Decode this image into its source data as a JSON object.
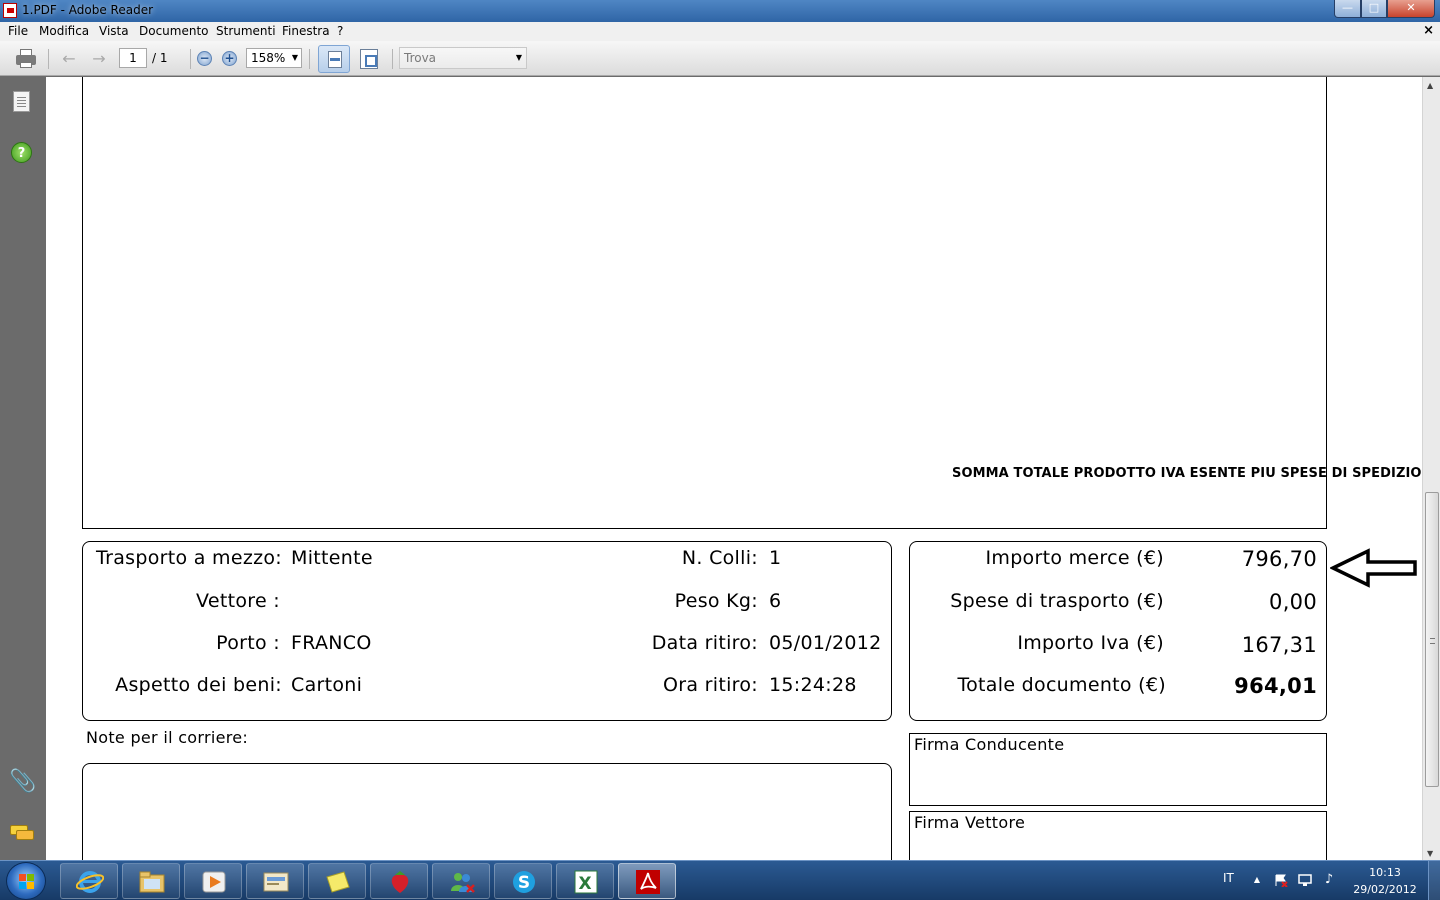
{
  "window": {
    "title": "1.PDF - Adobe Reader",
    "min_glyph": "—",
    "max_glyph": "□",
    "close_glyph": "✕"
  },
  "menu": {
    "items": [
      "File",
      "Modifica",
      "Vista",
      "Documento",
      "Strumenti",
      "Finestra",
      "?"
    ],
    "close_doc": "×"
  },
  "toolbar": {
    "page_current": "1",
    "page_total": "/ 1",
    "zoom": "158%",
    "find_placeholder": "Trova",
    "prev_glyph": "←",
    "next_glyph": "→",
    "zoom_out_glyph": "−",
    "zoom_in_glyph": "+",
    "dropdown_glyph": "▼"
  },
  "sidebar": {
    "help_glyph": "?",
    "attach_glyph": "📎",
    "icons": [
      "pages-icon",
      "help-icon",
      "attachments-icon",
      "comments-icon"
    ]
  },
  "document": {
    "total_note": "SOMMA TOTALE PRODOTTO IVA ESENTE PIU SPESE DI SPEDIZIONI",
    "shipping": {
      "trasporto_label": "Trasporto a mezzo:",
      "trasporto_value": "Mittente",
      "vettore_label": "Vettore :",
      "vettore_value": "",
      "porto_label": "Porto :",
      "porto_value": "FRANCO",
      "aspetto_label": "Aspetto dei beni:",
      "aspetto_value": "Cartoni",
      "colli_label": "N. Colli:",
      "colli_value": "1",
      "peso_label": "Peso Kg:",
      "peso_value": "6",
      "data_label": "Data ritiro:",
      "data_value": "05/01/2012",
      "ora_label": "Ora ritiro:",
      "ora_value": "15:24:28"
    },
    "totals": {
      "importo_merce_label": "Importo merce (€)",
      "importo_merce_value": "796,70",
      "spese_label": "Spese di trasporto (€)",
      "spese_value": "0,00",
      "iva_label": "Importo Iva (€)",
      "iva_value": "167,31",
      "totale_label": "Totale documento (€)",
      "totale_value": "964,01"
    },
    "note_label": "Note  per il corriere:",
    "firma_conducente": "Firma Conducente",
    "firma_vettore": "Firma Vettore"
  },
  "taskbar": {
    "apps": [
      "internet-explorer",
      "windows-explorer",
      "media-player",
      "mail",
      "sticky-notes",
      "strawberry-app",
      "messenger",
      "skype",
      "excel",
      "adobe-reader"
    ],
    "active_app": "adobe-reader",
    "language": "IT",
    "time": "10:13",
    "date": "29/02/2012",
    "tray_arrow": "▲",
    "tray_volume": "♪"
  },
  "colors": {
    "titlebar": "#3a73b5",
    "taskbar": "#1f4677",
    "app_bg": "#6b6b6b",
    "adobe_red": "#c00000"
  }
}
